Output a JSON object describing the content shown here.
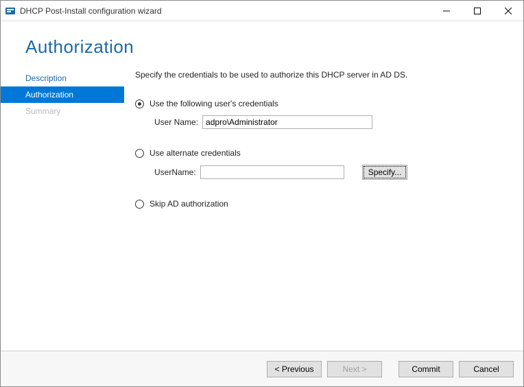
{
  "window": {
    "title": "DHCP Post-Install configuration wizard"
  },
  "page_title": "Authorization",
  "sidebar": {
    "items": [
      {
        "label": "Description"
      },
      {
        "label": "Authorization"
      },
      {
        "label": "Summary"
      }
    ]
  },
  "intro_text": "Specify the credentials to be used to authorize this DHCP server in AD DS.",
  "options": {
    "opt1": {
      "label": "Use the following user's credentials",
      "checked": true,
      "field_label": "User Name:",
      "field_value": "adpro\\Administrator"
    },
    "opt2": {
      "label": "Use alternate credentials",
      "checked": false,
      "field_label": "UserName:",
      "field_value": "",
      "specify_label": "Specify..."
    },
    "opt3": {
      "label": "Skip AD authorization",
      "checked": false
    }
  },
  "footer": {
    "previous": "< Previous",
    "next": "Next >",
    "commit": "Commit",
    "cancel": "Cancel"
  }
}
